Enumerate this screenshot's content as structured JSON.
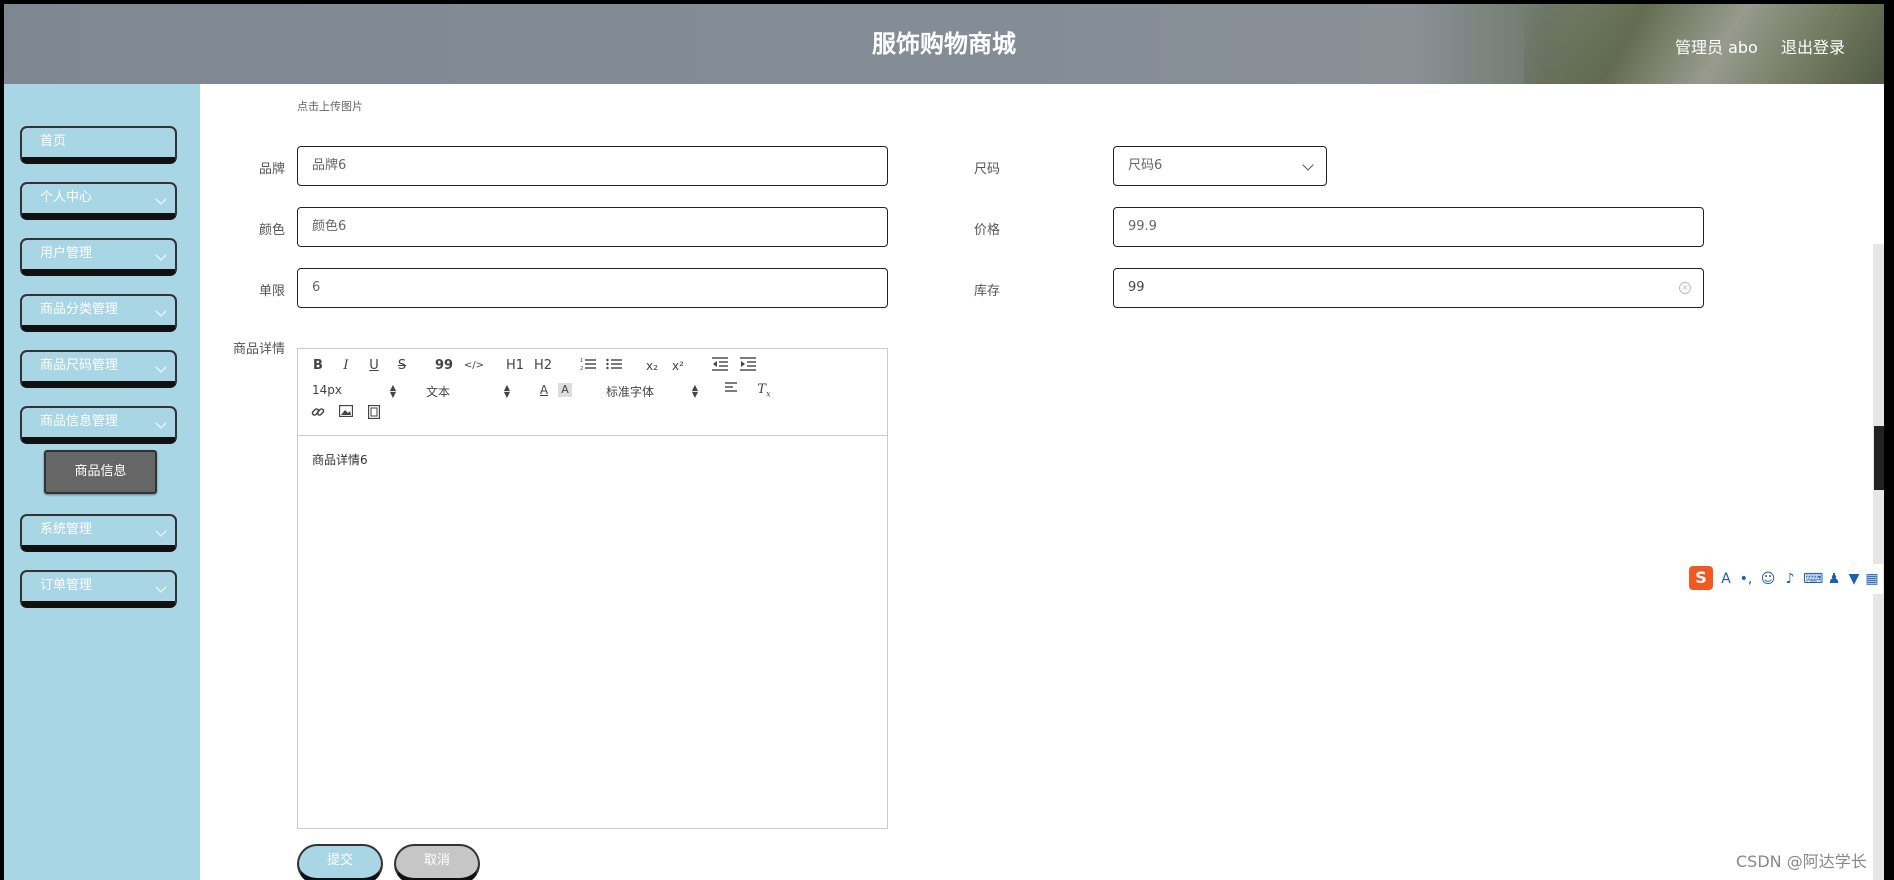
{
  "header": {
    "title": "服饰购物商城",
    "user": "管理员 abo",
    "logout": "退出登录"
  },
  "sidebar": {
    "items": [
      {
        "label": "首页"
      },
      {
        "label": "个人中心"
      },
      {
        "label": "用户管理"
      },
      {
        "label": "商品分类管理"
      },
      {
        "label": "商品尺码管理"
      },
      {
        "label": "商品信息管理"
      },
      {
        "label": "系统管理"
      },
      {
        "label": "订单管理"
      }
    ],
    "active_sub": "商品信息"
  },
  "form": {
    "upload_hint": "点击上传图片",
    "brand": {
      "label": "品牌",
      "value": "品牌6"
    },
    "size": {
      "label": "尺码",
      "value": "尺码6"
    },
    "color": {
      "label": "颜色",
      "value": "颜色6"
    },
    "price": {
      "label": "价格",
      "value": "99.9"
    },
    "limit": {
      "label": "单限",
      "value": "6"
    },
    "stock": {
      "label": "库存",
      "value": "99"
    },
    "detail": {
      "label": "商品详情",
      "value": "商品详情6"
    },
    "submit": "提交",
    "cancel": "取消"
  },
  "editor": {
    "font_size": "14px",
    "header_select": "文本",
    "font_family": "标准字体",
    "buttons": {
      "bold": "B",
      "italic": "I",
      "underline": "U",
      "strike": "S",
      "quote": "99",
      "code": "</>",
      "h1": "H1",
      "h2": "H2",
      "sub": "x₂",
      "sup": "x²"
    }
  },
  "watermark": "CSDN @阿达学长",
  "icons": [
    "chevron-down-icon",
    "list-ordered-icon",
    "list-bullet-icon",
    "indent-icon",
    "outdent-icon",
    "text-color-icon",
    "background-color-icon",
    "align-icon",
    "clear-format-icon",
    "link-icon",
    "image-icon",
    "video-icon",
    "clear-input-icon"
  ]
}
